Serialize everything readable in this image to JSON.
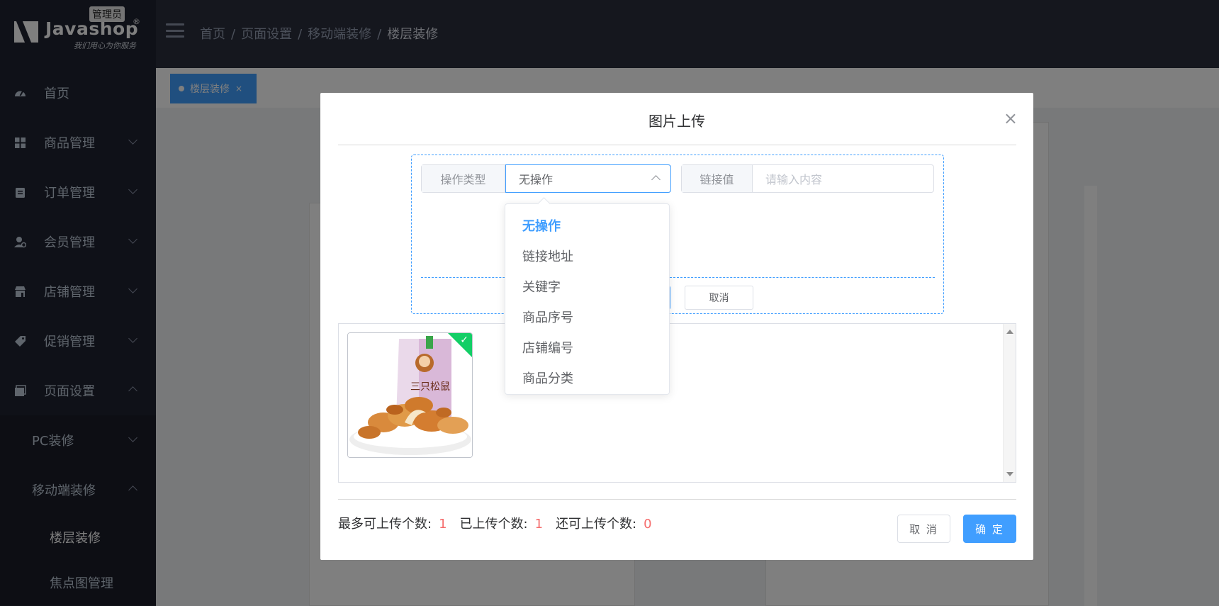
{
  "app": {
    "logo_name": "Javashop",
    "logo_reg": "®",
    "role_badge": "管理员",
    "slogan": "我们用心为你服务"
  },
  "sidebar": {
    "items": [
      {
        "label": "首页",
        "icon": "dashboard-icon"
      },
      {
        "label": "商品管理",
        "icon": "grid-icon"
      },
      {
        "label": "订单管理",
        "icon": "clipboard-icon"
      },
      {
        "label": "会员管理",
        "icon": "user-icon"
      },
      {
        "label": "店铺管理",
        "icon": "store-icon"
      },
      {
        "label": "促销管理",
        "icon": "tag-icon"
      },
      {
        "label": "页面设置",
        "icon": "window-icon"
      }
    ],
    "sub_items": [
      {
        "label": "PC装修"
      },
      {
        "label": "移动端装修"
      }
    ],
    "sub_sub_items": [
      {
        "label": "楼层装修"
      },
      {
        "label": "焦点图管理"
      }
    ]
  },
  "header": {
    "breadcrumb": [
      "首页",
      "页面设置",
      "移动端装修",
      "楼层装修"
    ],
    "breadcrumb_sep": "/"
  },
  "tabs": {
    "active_label": "楼层装修",
    "close": "×"
  },
  "dialog": {
    "title": "图片上传",
    "close": "×",
    "op_type_label": "操作类型",
    "op_type_value": "无操作",
    "link_label": "链接值",
    "link_placeholder": "请输入内容",
    "op_cancel": "取消",
    "stats": {
      "max_label": "最多可上传个数:",
      "max_value": "1",
      "uploaded_label": "已上传个数:",
      "uploaded_value": "1",
      "remaining_label": "还可上传个数:",
      "remaining_value": "0"
    },
    "cancel_button": "取 消",
    "confirm_button": "确 定",
    "checkmark": "✓"
  },
  "dropdown": {
    "options": [
      "无操作",
      "链接地址",
      "关键字",
      "商品序号",
      "店铺编号",
      "商品分类"
    ],
    "selected": "无操作"
  },
  "colors": {
    "primary": "#409eff",
    "danger": "#f56c6c",
    "success": "#13ce66",
    "sidebar_bg": "#1f2231"
  }
}
